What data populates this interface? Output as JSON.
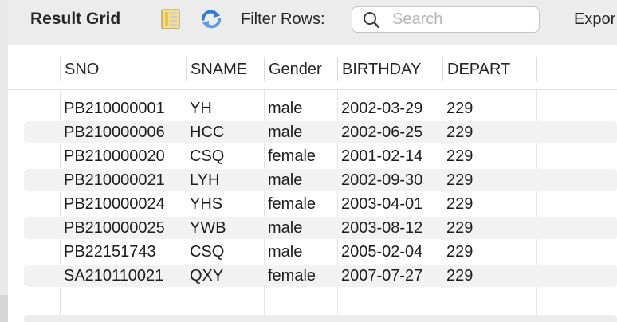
{
  "toolbar": {
    "title": "Result Grid",
    "filter_label": "Filter Rows:",
    "search_placeholder": "Search",
    "search_value": "",
    "export_label": "Expor"
  },
  "grid": {
    "columns": [
      "SNO",
      "SNAME",
      "Gender",
      "BIRTHDAY",
      "DEPART"
    ],
    "rows": [
      [
        "PB210000001",
        "YH",
        "male",
        "2002-03-29",
        "229"
      ],
      [
        "PB210000006",
        "HCC",
        "male",
        "2002-06-25",
        "229"
      ],
      [
        "PB210000020",
        "CSQ",
        "female",
        "2001-02-14",
        "229"
      ],
      [
        "PB210000021",
        "LYH",
        "male",
        "2002-09-30",
        "229"
      ],
      [
        "PB210000024",
        "YHS",
        "female",
        "2003-04-01",
        "229"
      ],
      [
        "PB210000025",
        "YWB",
        "male",
        "2003-08-12",
        "229"
      ],
      [
        "PB22151743",
        "CSQ",
        "male",
        "2005-02-04",
        "229"
      ],
      [
        "SA210110021",
        "QXY",
        "female",
        "2007-07-27",
        "229"
      ]
    ]
  },
  "icons": {
    "form_editor": "form-editor-icon",
    "refresh": "refresh-icon",
    "search": "search-icon"
  },
  "colors": {
    "toolbar_bg": "#ececec",
    "stripe": "#f2f2f2",
    "refresh_blue": "#2f7bd6",
    "form_yellow": "#e8c24a"
  }
}
